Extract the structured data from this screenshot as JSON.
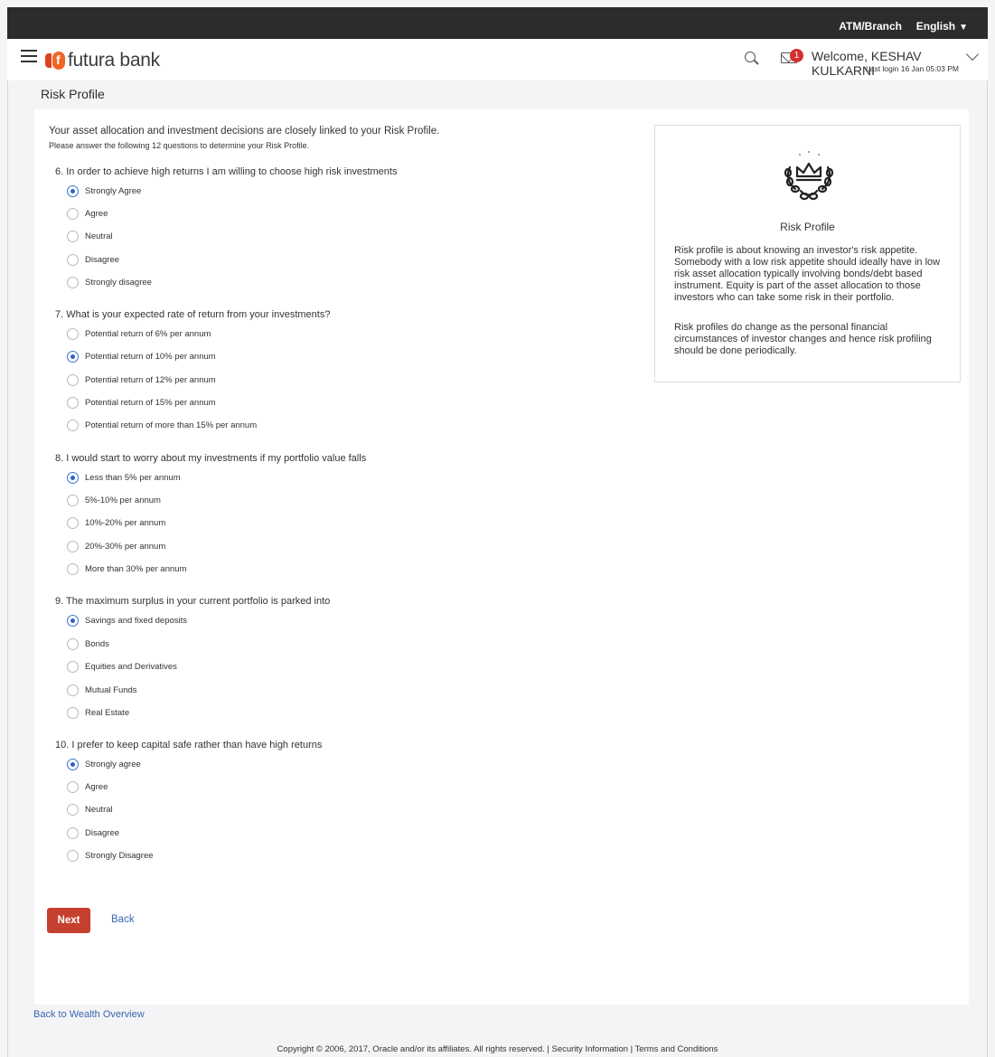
{
  "topbar": {
    "atm_branch": "ATM/Branch",
    "language": "English",
    "caret": "▼"
  },
  "header": {
    "logo_text": "futura bank",
    "notification_count": "1",
    "welcome": "Welcome, KESHAV KULKARNI",
    "last_login": "Last login 16 Jan 05:03 PM"
  },
  "page": {
    "title": "Risk Profile",
    "intro_line1": "Your asset allocation and investment decisions are closely linked to your Risk Profile.",
    "intro_line2": "Please answer the following 12 questions to determine your Risk Profile."
  },
  "questions": [
    {
      "text": "6. In order to achieve high returns I am willing to choose high risk investments",
      "options": [
        "Strongly Agree",
        "Agree",
        "Neutral",
        "Disagree",
        "Strongly disagree"
      ],
      "selected": 0
    },
    {
      "text": "7. What is your expected rate of return from your investments?",
      "options": [
        "Potential return of 6% per annum",
        "Potential return of 10% per annum",
        "Potential return of 12% per annum",
        "Potential return of 15% per annum",
        "Potential return of more than 15% per annum"
      ],
      "selected": 1
    },
    {
      "text": "8. I would start to worry about my investments if my portfolio value falls",
      "options": [
        "Less than 5% per annum",
        "5%-10% per annum",
        "10%-20% per annum",
        "20%-30% per annum",
        "More than 30% per annum"
      ],
      "selected": 0
    },
    {
      "text": "9. The maximum surplus in your current portfolio is parked into",
      "options": [
        "Savings and fixed deposits",
        "Bonds",
        "Equities and Derivatives",
        "Mutual Funds",
        "Real Estate"
      ],
      "selected": 0
    },
    {
      "text": "10. I prefer to keep capital safe rather than have high returns",
      "options": [
        "Strongly agree",
        "Agree",
        "Neutral",
        "Disagree",
        "Strongly Disagree"
      ],
      "selected": 0
    }
  ],
  "sidebar": {
    "icon": "crown-laurel-icon",
    "title": "Risk Profile",
    "para1": "Risk profile is about knowing an investor's risk appetite. Somebody with a low risk appetite should ideally have in low risk asset allocation typically involving bonds/debt based instrument. Equity is part of the asset allocation to those investors who can take some risk in their portfolio.",
    "para2": "Risk profiles do change as the personal financial circumstances of investor changes and hence risk profiling should be done periodically."
  },
  "actions": {
    "next": "Next",
    "back": "Back"
  },
  "links": {
    "back_to_wealth": "Back to Wealth Overview"
  },
  "footer": {
    "copyright": "Copyright © 2006, 2017, Oracle and/or its affiliates. All rights reserved. | Security Information | Terms and Conditions"
  },
  "colors": {
    "primary_button": "#c6402f",
    "link": "#3a66b0",
    "radio_selected": "#2e63c8",
    "topbar": "#2c2c2c"
  }
}
